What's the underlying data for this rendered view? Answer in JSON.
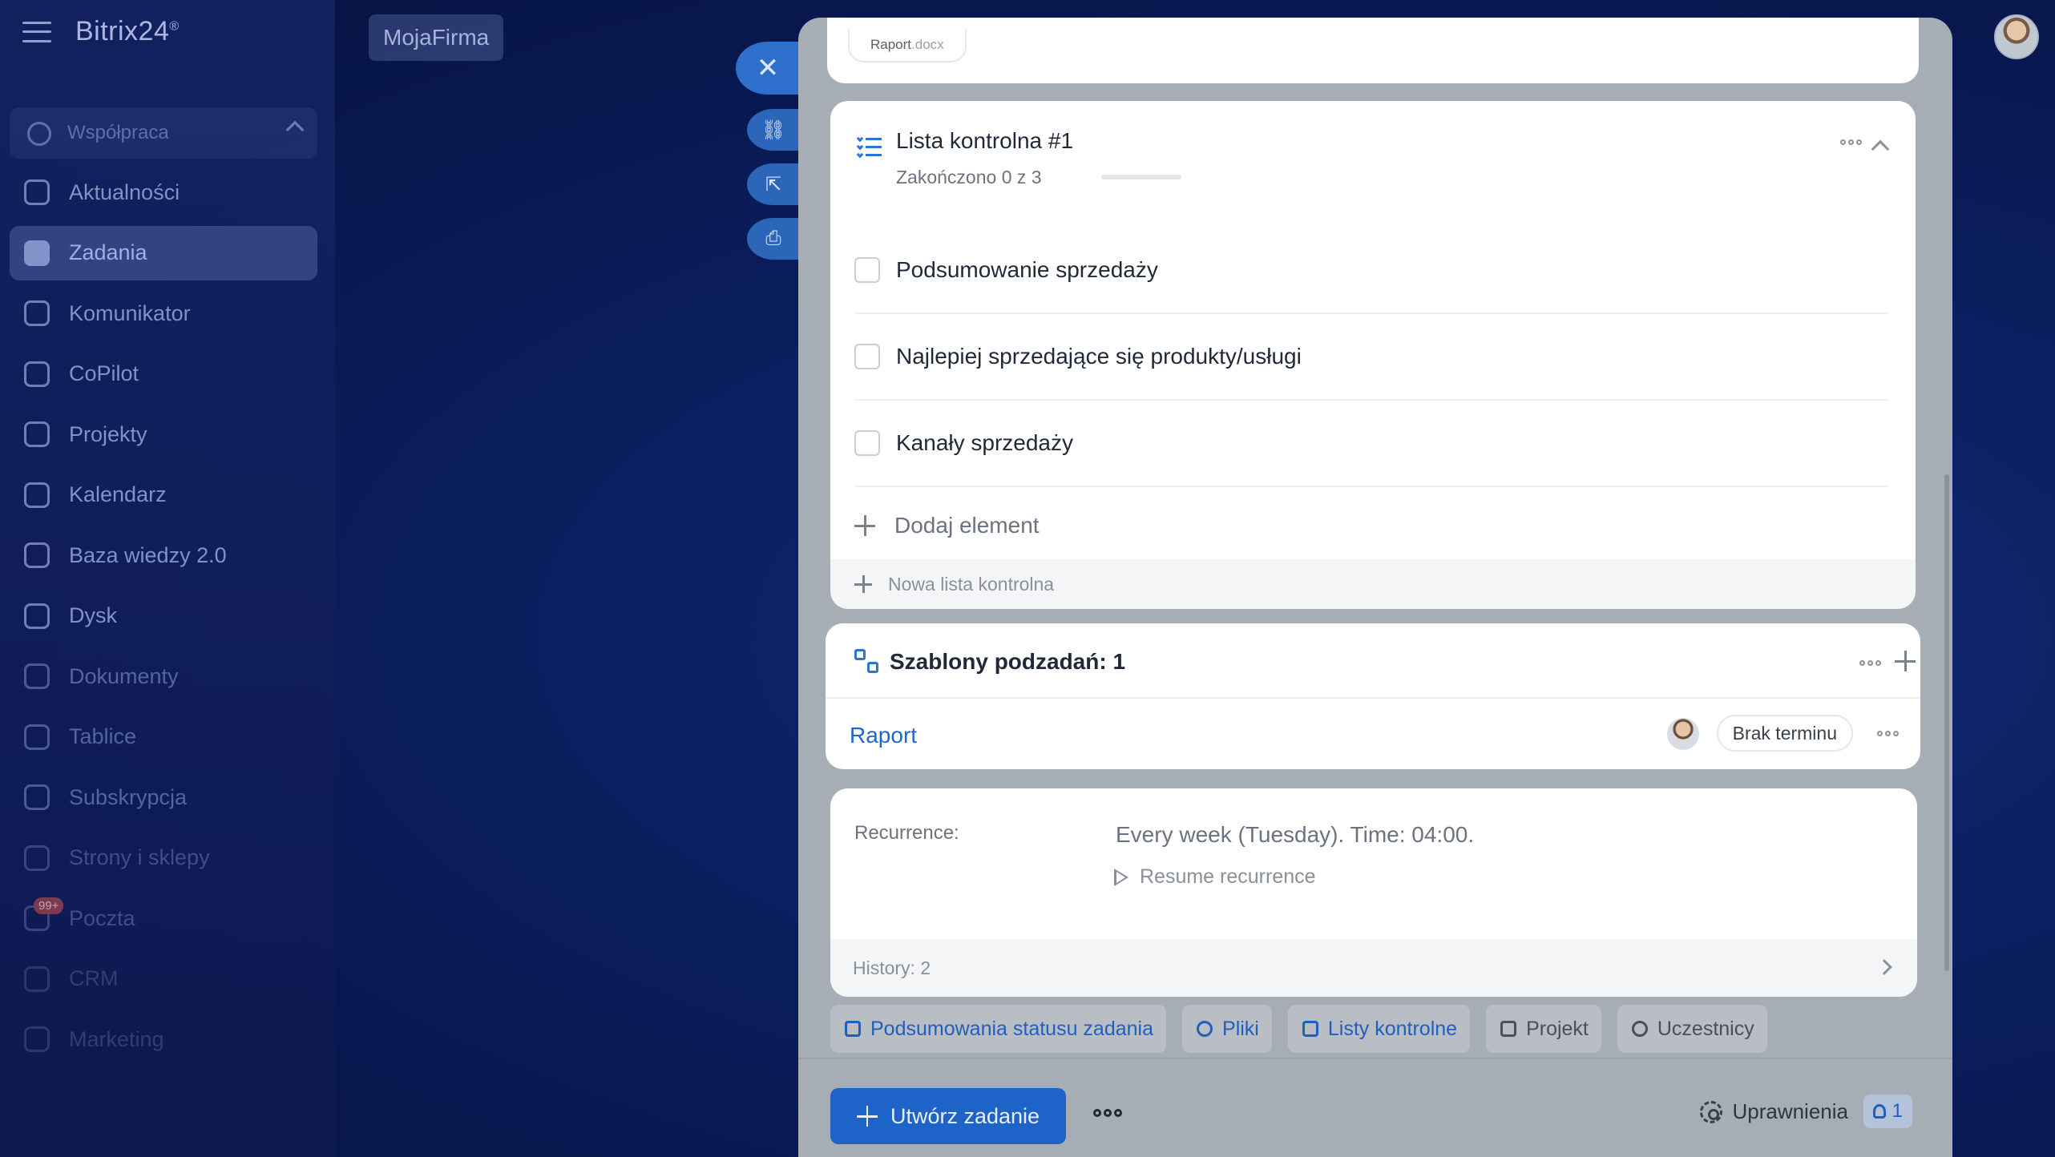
{
  "brand": {
    "name": "Bitrix24",
    "mark": "®"
  },
  "company_button": "MojaFirma",
  "sidebar": {
    "group_label": "Współpraca",
    "items": [
      {
        "label": "Aktualności",
        "icon": "news-icon",
        "active": false
      },
      {
        "label": "Zadania",
        "icon": "tasks-icon",
        "active": true
      },
      {
        "label": "Komunikator",
        "icon": "chat-icon",
        "active": false
      },
      {
        "label": "CoPilot",
        "icon": "copilot-icon",
        "active": false
      },
      {
        "label": "Projekty",
        "icon": "projects-icon",
        "active": false
      },
      {
        "label": "Kalendarz",
        "icon": "calendar-icon",
        "active": false
      },
      {
        "label": "Baza wiedzy 2.0",
        "icon": "knowledge-icon",
        "active": false
      },
      {
        "label": "Dysk",
        "icon": "drive-icon",
        "active": false
      },
      {
        "label": "Dokumenty",
        "icon": "documents-icon",
        "active": false
      },
      {
        "label": "Tablice",
        "icon": "boards-icon",
        "active": false
      },
      {
        "label": "Subskrypcja",
        "icon": "subscription-icon",
        "active": false
      },
      {
        "label": "Strony i sklepy",
        "icon": "cart-icon",
        "active": false
      },
      {
        "label": "Poczta",
        "icon": "mail-icon",
        "active": false,
        "badge": "99+"
      },
      {
        "label": "CRM",
        "icon": "crm-icon",
        "active": false
      },
      {
        "label": "Marketing",
        "icon": "marketing-icon",
        "active": false
      }
    ]
  },
  "file_card": {
    "name": "Raport",
    "ext": ".docx"
  },
  "checklist": {
    "title": "Lista kontrolna #1",
    "progress_text": "Zakończono 0 z 3",
    "progress_value": 0,
    "items": [
      "Podsumowanie sprzedaży",
      "Najlepiej sprzedające się produkty/usługi",
      "Kanały sprzedaży"
    ],
    "add_label": "Dodaj element",
    "new_list_label": "Nowa lista kontrolna"
  },
  "subtasks": {
    "title": "Szablony podzadań: 1",
    "item_name": "Raport",
    "deadline": "Brak terminu"
  },
  "recurrence": {
    "label": "Recurrence:",
    "value": "Every week (Tuesday). Time: 04:00.",
    "resume_label": "Resume recurrence",
    "history_label": "History: 2"
  },
  "chips": [
    {
      "label": "Podsumowania statusu zadania",
      "style": "blue"
    },
    {
      "label": "Pliki",
      "style": "blue"
    },
    {
      "label": "Listy kontrolne",
      "style": "blue"
    },
    {
      "label": "Projekt",
      "style": "gray"
    },
    {
      "label": "Uczestnicy",
      "style": "gray"
    }
  ],
  "footer": {
    "create_label": "Utwórz zadanie",
    "permissions_label": "Uprawnienia",
    "participants_count": "1"
  },
  "colors": {
    "accent": "#1e63c7",
    "link": "#2166c9"
  }
}
